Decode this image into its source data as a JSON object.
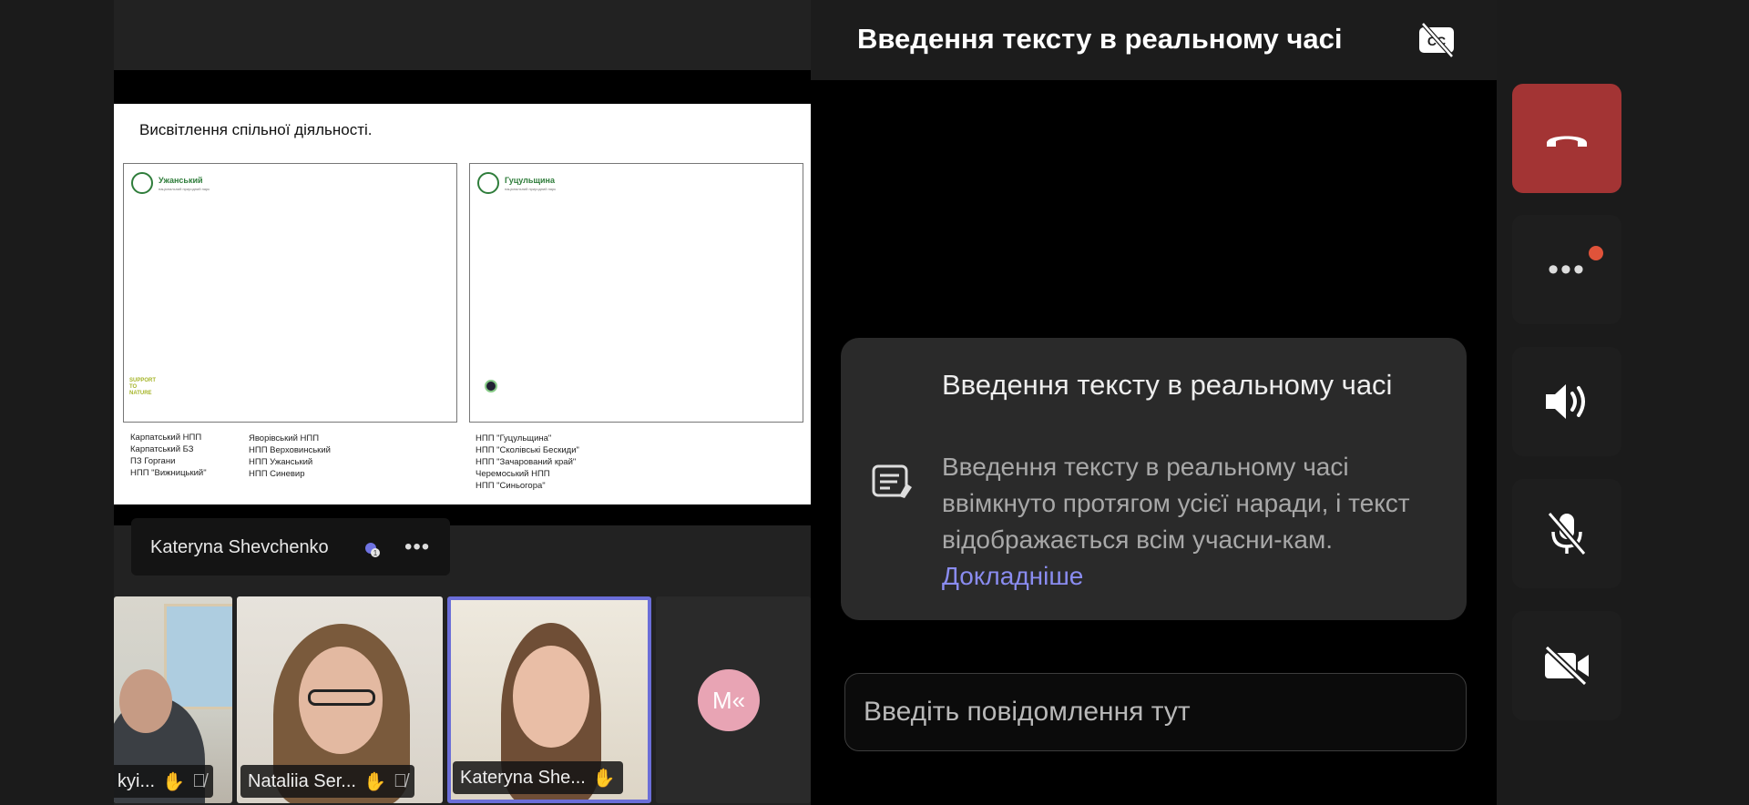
{
  "slide": {
    "title": "Висвітлення спільної діяльності.",
    "left_panel": {
      "org_name": "Ужанський",
      "org_sub": "національний природний парк",
      "footer_logo": "SUPPORT TO NATURE"
    },
    "right_panel": {
      "org_name": "Гуцульщина",
      "org_sub": "національний природний парк"
    },
    "list_col1": "Карпатський НПП\nКарпатський БЗ\nПЗ Горгани\nНПП \"Вижницький\"",
    "list_col2": "Яворівський НПП\nНПП Верховинський\nНПП Ужанський\nНПП Синевир",
    "list_col3": "НПП \"Гуцульщина\"\nНПП \"Сколівські Бескиди\"\nНПП \"Зачарований край\"\nЧеремоський НПП\nНПП \"Синьогора\""
  },
  "speaker": {
    "name": "Kateryna Shevchenko"
  },
  "participants": [
    {
      "name": "kyi..."
    },
    {
      "name": "Nataliia Ser..."
    },
    {
      "name": "Kateryna She..."
    },
    {
      "initials": "M«"
    }
  ],
  "captions_panel": {
    "title": "Введення тексту в реальному часі",
    "info_title": "Введення тексту в реальному часі",
    "info_body": "Введення тексту в реальному часі ввімкнуто протягом усієї наради, і текст відображається всім учасни-кам.",
    "info_link": "Докладніше",
    "input_placeholder": "Введіть повідомлення тут"
  },
  "colors": {
    "end_call": "#a33434",
    "link": "#8a8cf0",
    "active_tile_border": "#6b6ed8",
    "avatar_bg": "#e8a4b4",
    "notification_dot": "#e0533a"
  }
}
